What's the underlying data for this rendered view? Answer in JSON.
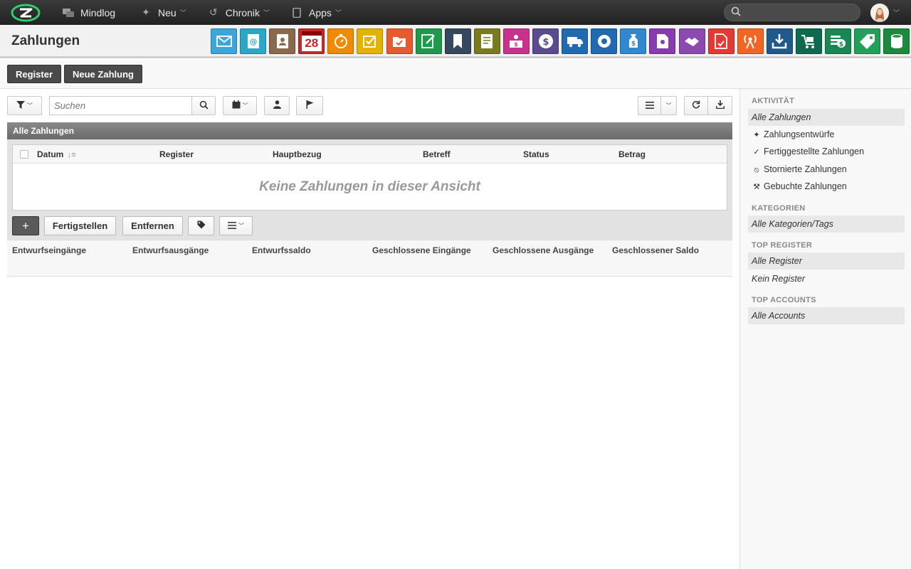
{
  "topnav": {
    "items": [
      {
        "label": "Mindlog",
        "icon": "chat-icon"
      },
      {
        "label": "Neu",
        "icon": "sparkle-icon"
      },
      {
        "label": "Chronik",
        "icon": "history-icon"
      },
      {
        "label": "Apps",
        "icon": "tablet-icon"
      }
    ],
    "search_placeholder": ""
  },
  "header": {
    "title": "Zahlungen",
    "app_icons": [
      {
        "name": "mail-app-icon",
        "color": "#3aa6d9"
      },
      {
        "name": "email-marketing-app-icon",
        "color": "#2aa8c8"
      },
      {
        "name": "contacts-app-icon",
        "color": "#8a6a4a"
      },
      {
        "name": "calendar-app-icon",
        "color": "#c62828",
        "text": "28"
      },
      {
        "name": "timer-app-icon",
        "color": "#f08a00"
      },
      {
        "name": "tasks-app-icon",
        "color": "#e2b400"
      },
      {
        "name": "cases-app-icon",
        "color": "#e65a2b"
      },
      {
        "name": "notes-app-icon",
        "color": "#1f9a4c"
      },
      {
        "name": "bookmark-app-icon",
        "color": "#34495e"
      },
      {
        "name": "documents-app-icon",
        "color": "#7a7a1e"
      },
      {
        "name": "sales-app-icon",
        "color": "#c8328c"
      },
      {
        "name": "finance-app-icon",
        "color": "#5a4a8e"
      },
      {
        "name": "shipping-app-icon",
        "color": "#1f6ab0"
      },
      {
        "name": "support-app-icon",
        "color": "#1f6ab0"
      },
      {
        "name": "payments-app-icon",
        "color": "#2f88d0"
      },
      {
        "name": "contracts-app-icon",
        "color": "#8a3ab0"
      },
      {
        "name": "partners-app-icon",
        "color": "#8a4ab0"
      },
      {
        "name": "pdf-app-icon",
        "color": "#e53935"
      },
      {
        "name": "broadcast-app-icon",
        "color": "#f26522"
      },
      {
        "name": "download-app-icon",
        "color": "#1f5a8a"
      },
      {
        "name": "purchasing-app-icon",
        "color": "#0e6a4e"
      },
      {
        "name": "cash-app-icon",
        "color": "#198754"
      },
      {
        "name": "pricing-app-icon",
        "color": "#21a05a"
      },
      {
        "name": "database-app-icon",
        "color": "#1b8a3e"
      }
    ]
  },
  "actions": {
    "register": "Register",
    "new_payment": "Neue Zahlung"
  },
  "toolbar": {
    "search_placeholder": "Suchen"
  },
  "list": {
    "title": "Alle Zahlungen",
    "columns": [
      "Datum",
      "Register",
      "Hauptbezug",
      "Betreff",
      "Status",
      "Betrag"
    ],
    "empty_message": "Keine Zahlungen in dieser Ansicht",
    "bulk": {
      "add": "+",
      "complete": "Fertigstellen",
      "remove": "Entfernen"
    }
  },
  "summary": {
    "labels": [
      "Entwurfseingänge",
      "Entwurfsausgänge",
      "Entwurfssaldo",
      "Geschlossene Eingänge",
      "Geschlossene Ausgänge",
      "Geschlossener Saldo"
    ]
  },
  "sidebar": {
    "activity_heading": "AKTIVITÄT",
    "activity": [
      {
        "label": "Alle Zahlungen",
        "icon": ""
      },
      {
        "label": "Zahlungsentwürfe",
        "icon": "sparkle-icon"
      },
      {
        "label": "Fertiggestellte Zahlungen",
        "icon": "double-check-icon"
      },
      {
        "label": "Stornierte Zahlungen",
        "icon": "cancel-icon"
      },
      {
        "label": "Gebuchte Zahlungen",
        "icon": "hammer-icon"
      }
    ],
    "categories_heading": "KATEGORIEN",
    "categories": [
      {
        "label": "Alle Kategorien/Tags"
      }
    ],
    "registers_heading": "TOP REGISTER",
    "registers": [
      {
        "label": "Alle Register"
      },
      {
        "label": "Kein Register"
      }
    ],
    "accounts_heading": "TOP ACCOUNTS",
    "accounts": [
      {
        "label": "Alle Accounts"
      }
    ]
  }
}
